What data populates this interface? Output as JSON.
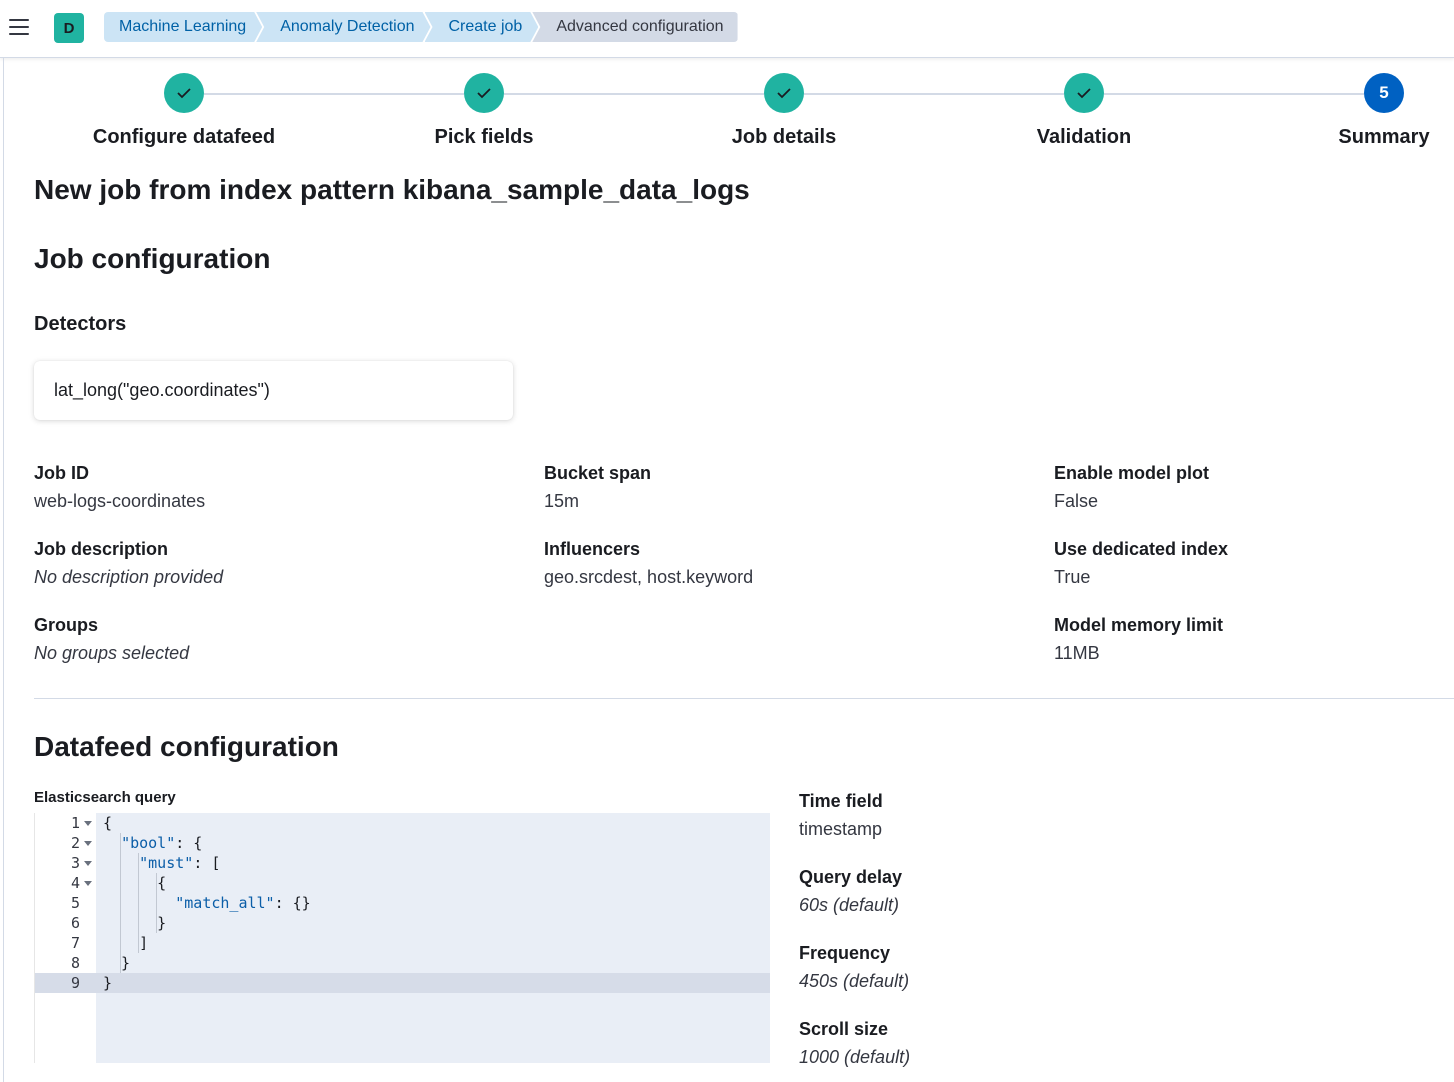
{
  "header": {
    "space_initial": "D",
    "breadcrumbs": [
      "Machine Learning",
      "Anomaly Detection",
      "Create job",
      "Advanced configuration"
    ]
  },
  "steps": [
    {
      "label": "Configure datafeed",
      "status": "complete"
    },
    {
      "label": "Pick fields",
      "status": "complete"
    },
    {
      "label": "Job details",
      "status": "complete"
    },
    {
      "label": "Validation",
      "status": "complete"
    },
    {
      "label": "Summary",
      "status": "current",
      "number": "5"
    }
  ],
  "page_title": "New job from index pattern kibana_sample_data_logs",
  "job_config": {
    "heading": "Job configuration",
    "detectors_heading": "Detectors",
    "detector": "lat_long(\"geo.coordinates\")",
    "fields": {
      "job_id": {
        "title": "Job ID",
        "value": "web-logs-coordinates"
      },
      "job_description": {
        "title": "Job description",
        "value": "No description provided"
      },
      "groups": {
        "title": "Groups",
        "value": "No groups selected"
      },
      "bucket_span": {
        "title": "Bucket span",
        "value": "15m"
      },
      "influencers": {
        "title": "Influencers",
        "value": "geo.srcdest, host.keyword"
      },
      "model_plot": {
        "title": "Enable model plot",
        "value": "False"
      },
      "dedicated_index": {
        "title": "Use dedicated index",
        "value": "True"
      },
      "memory_limit": {
        "title": "Model memory limit",
        "value": "11MB"
      }
    }
  },
  "datafeed_config": {
    "heading": "Datafeed configuration",
    "query_label": "Elasticsearch query",
    "query_lines": [
      {
        "no": "1",
        "fold": true
      },
      {
        "no": "2",
        "fold": true,
        "key": "\"bool\"",
        "rest": ": {"
      },
      {
        "no": "3",
        "fold": true,
        "key": "\"must\"",
        "rest": ": ["
      },
      {
        "no": "4",
        "fold": true
      },
      {
        "no": "5",
        "fold": false,
        "key": "\"match_all\"",
        "rest": ": {}"
      },
      {
        "no": "6",
        "fold": false
      },
      {
        "no": "7",
        "fold": false
      },
      {
        "no": "8",
        "fold": false
      },
      {
        "no": "9",
        "fold": false
      }
    ],
    "fields": {
      "time_field": {
        "title": "Time field",
        "value": "timestamp"
      },
      "query_delay": {
        "title": "Query delay",
        "value": "60s (default)"
      },
      "frequency": {
        "title": "Frequency",
        "value": "450s (default)"
      },
      "scroll_size": {
        "title": "Scroll size",
        "value": "1000 (default)"
      }
    }
  }
}
